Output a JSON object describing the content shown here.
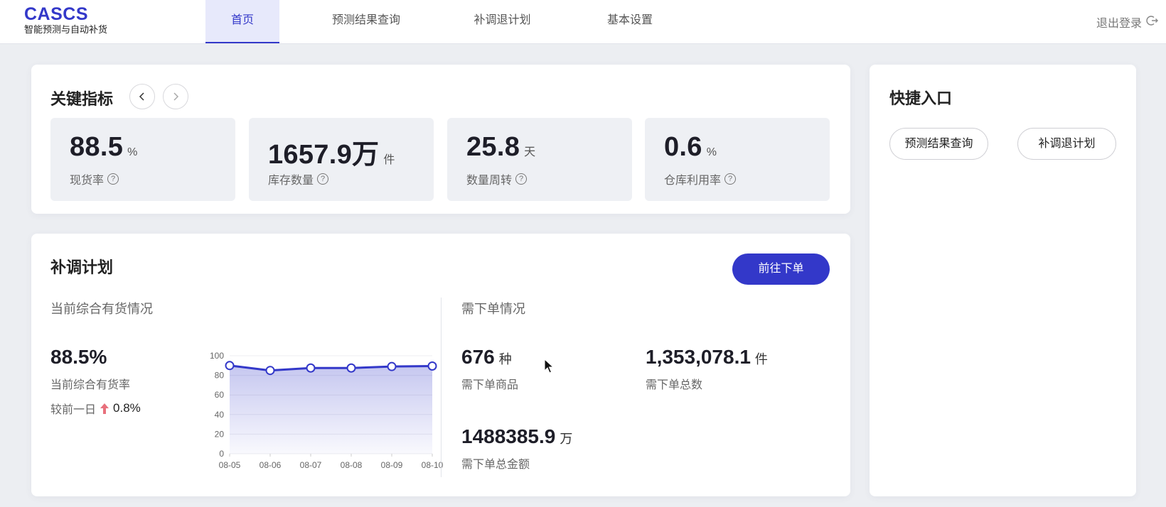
{
  "brand": {
    "name": "CASCS",
    "subtitle": "智能预测与自动补货"
  },
  "nav": {
    "tabs": [
      {
        "label": "首页",
        "active": true
      },
      {
        "label": "预测结果查询",
        "active": false
      },
      {
        "label": "补调退计划",
        "active": false
      },
      {
        "label": "基本设置",
        "active": false
      }
    ],
    "logout_label": "退出登录"
  },
  "kpi": {
    "title": "关键指标",
    "items": [
      {
        "value": "88.5",
        "unit": "%",
        "label": "现货率"
      },
      {
        "value": "1657.9万",
        "unit": "件",
        "label": "库存数量"
      },
      {
        "value": "25.8",
        "unit": "天",
        "label": "数量周转"
      },
      {
        "value": "0.6",
        "unit": "%",
        "label": "仓库利用率"
      }
    ]
  },
  "plan": {
    "title": "补调计划",
    "order_button": "前往下单",
    "availability": {
      "section_title": "当前综合有货情况",
      "rate": "88.5%",
      "rate_label": "当前综合有货率",
      "change_label": "较前一日",
      "change_value": "0.8%"
    },
    "orders": {
      "section_title": "需下单情况",
      "items_value": "676",
      "items_unit": "种",
      "items_label": "需下单商品",
      "total_value": "1,353,078.1",
      "total_unit": "件",
      "total_label": "需下单总数",
      "amount_value": "1488385.9",
      "amount_unit": "万",
      "amount_label": "需下单总金额"
    }
  },
  "chart_data": {
    "type": "area",
    "categories": [
      "08-05",
      "08-06",
      "08-07",
      "08-08",
      "08-09",
      "08-10"
    ],
    "values": [
      90,
      85,
      87.5,
      87.5,
      89,
      89.5
    ],
    "yticks": [
      0,
      20,
      40,
      60,
      80,
      100
    ],
    "ylim": [
      0,
      100
    ],
    "title": "",
    "xlabel": "",
    "ylabel": "",
    "line_color": "#3338c9",
    "grid": true
  },
  "quick": {
    "title": "快捷入口",
    "buttons": [
      "预测结果查询",
      "补调退计划"
    ]
  },
  "colors": {
    "accent": "#3338c9",
    "up_arrow": "#e8707c"
  }
}
